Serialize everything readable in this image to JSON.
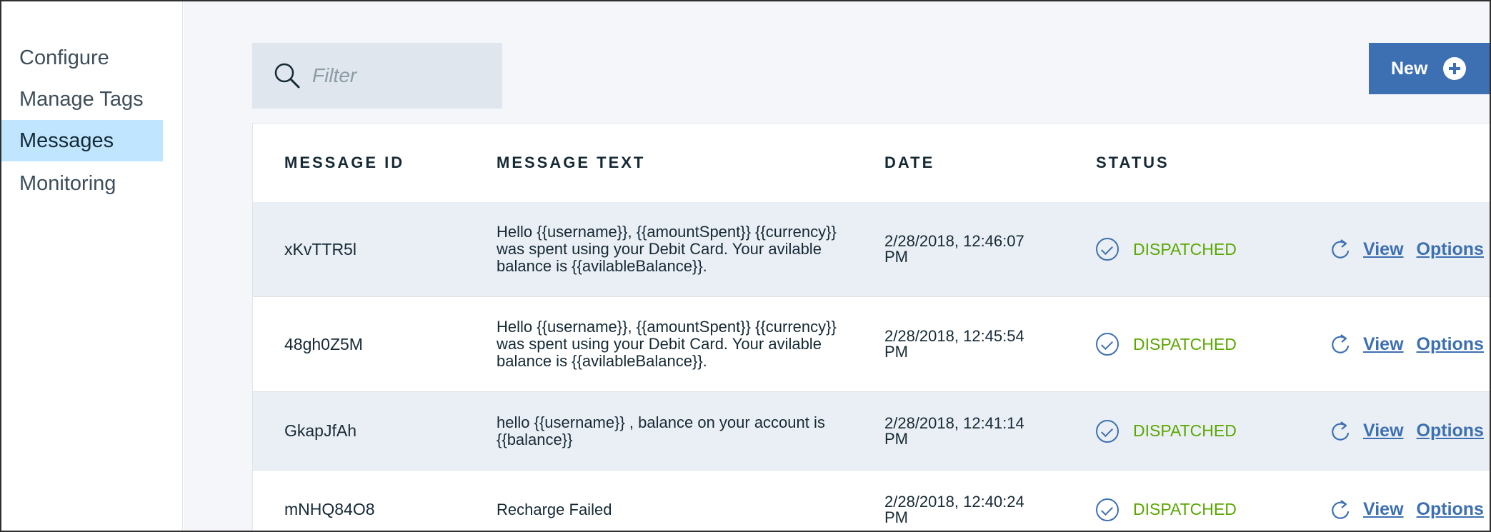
{
  "sidebar": {
    "items": [
      {
        "label": "Configure",
        "active": false
      },
      {
        "label": "Manage Tags",
        "active": false
      },
      {
        "label": "Messages",
        "active": true
      },
      {
        "label": "Monitoring",
        "active": false
      }
    ]
  },
  "toolbar": {
    "filter_placeholder": "Filter",
    "new_label": "New"
  },
  "table": {
    "headers": [
      "MESSAGE ID",
      "MESSAGE TEXT",
      "DATE",
      "STATUS"
    ],
    "rows": [
      {
        "id": "xKvTTR5l",
        "text": "Hello {{username}}, {{amountSpent}} {{currency}} was spent using your Debit Card. Your avilable balance is {{avilableBalance}}.",
        "date": "2/28/2018, 12:46:07 PM",
        "status": "DISPATCHED",
        "view": "View",
        "options": "Options"
      },
      {
        "id": "48gh0Z5M",
        "text": "Hello {{username}}, {{amountSpent}} {{currency}} was spent using your Debit Card. Your avilable balance is {{avilableBalance}}.",
        "date": "2/28/2018, 12:45:54 PM",
        "status": "DISPATCHED",
        "view": "View",
        "options": "Options"
      },
      {
        "id": "GkapJfAh",
        "text": "hello {{username}} , balance on your account is {{balance}}",
        "date": "2/28/2018, 12:41:14 PM",
        "status": "DISPATCHED",
        "view": "View",
        "options": "Options"
      },
      {
        "id": "mNHQ84O8",
        "text": "Recharge Failed",
        "date": "2/28/2018, 12:40:24 PM",
        "status": "DISPATCHED",
        "view": "View",
        "options": "Options"
      }
    ]
  },
  "colors": {
    "accent": "#3d70b2",
    "active_nav": "#c0e6ff",
    "status_ok": "#5aa700",
    "row_shade": "#eaeff5"
  },
  "icons": {
    "search": "search-icon",
    "add": "plus-circle-icon",
    "status": "check-circle-icon",
    "refresh": "refresh-icon"
  }
}
